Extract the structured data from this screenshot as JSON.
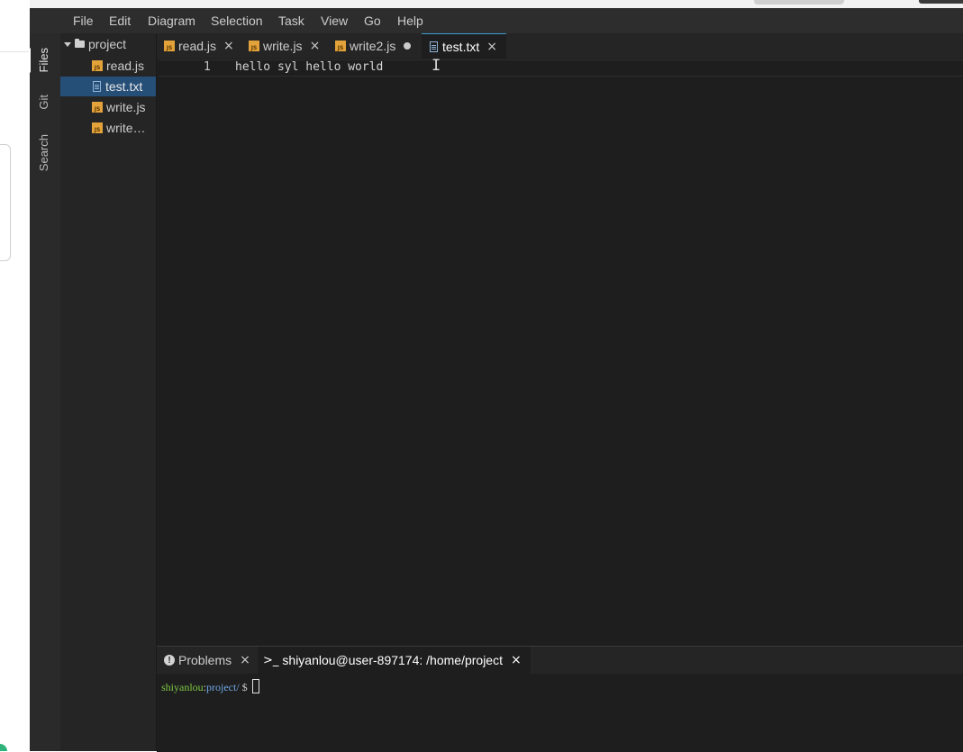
{
  "menu": [
    "File",
    "Edit",
    "Diagram",
    "Selection",
    "Task",
    "View",
    "Go",
    "Help"
  ],
  "activity_tabs": [
    "Files",
    "Git",
    "Search"
  ],
  "explorer": {
    "folder": "project",
    "files": [
      {
        "name": "read.js",
        "type": "js"
      },
      {
        "name": "test.txt",
        "type": "txt",
        "selected": true
      },
      {
        "name": "write.js",
        "type": "js"
      },
      {
        "name": "write…",
        "type": "js"
      }
    ]
  },
  "tabs": [
    {
      "label": "read.js",
      "type": "js",
      "state": "close"
    },
    {
      "label": "write.js",
      "type": "js",
      "state": "close"
    },
    {
      "label": "write2.js",
      "type": "js",
      "state": "modified"
    },
    {
      "label": "test.txt",
      "type": "txt",
      "state": "close",
      "active": true
    }
  ],
  "editor": {
    "line_number": "1",
    "line_text": "hello syl hello world"
  },
  "panel": {
    "problems_label": "Problems",
    "terminal_label": "shiyanlou@user-897174: /home/project",
    "terminal_icon": ">_",
    "terminal": {
      "user": "shiyanlou",
      "colon": ":",
      "path": "project/",
      "prompt": "$"
    }
  },
  "icons": {
    "js": "JS",
    "close": "×",
    "warn": "!",
    "ibeam": "I"
  }
}
